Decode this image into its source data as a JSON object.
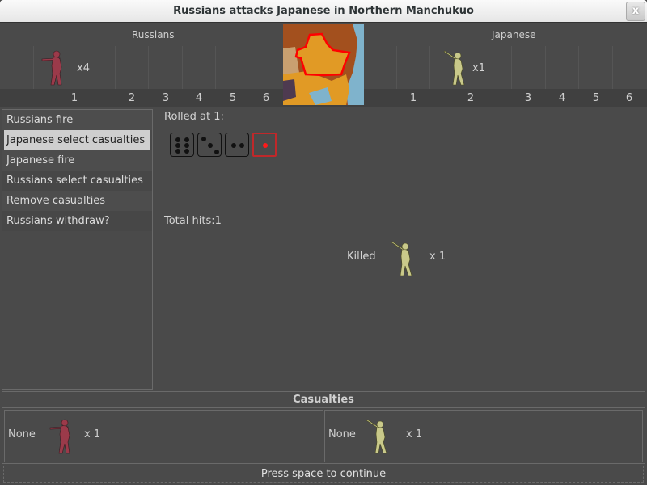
{
  "window": {
    "title": "Russians attacks Japanese in Northern Manchukuo",
    "close_label": "x"
  },
  "attacker": {
    "name": "Russians",
    "color": "#9b3a4a",
    "slots": [
      {
        "number": "1",
        "count": "x4"
      },
      {
        "number": "2"
      },
      {
        "number": "3"
      },
      {
        "number": "4"
      },
      {
        "number": "5"
      },
      {
        "number": "6"
      }
    ]
  },
  "defender": {
    "name": "Japanese",
    "color": "#c9c98a",
    "slots": [
      {
        "number": "1"
      },
      {
        "number": "2",
        "count": "x1"
      },
      {
        "number": "3"
      },
      {
        "number": "4"
      },
      {
        "number": "5"
      },
      {
        "number": "6"
      }
    ]
  },
  "territory": {
    "name": "Northern Manchukuo",
    "highlight_color": "#ff0000"
  },
  "phases": [
    {
      "label": "Russians fire",
      "selected": false
    },
    {
      "label": "Japanese select casualties",
      "selected": true
    },
    {
      "label": "Japanese fire",
      "selected": false
    },
    {
      "label": "Russians select casualties",
      "selected": false
    },
    {
      "label": "Remove casualties",
      "selected": false
    },
    {
      "label": "Russians withdraw?",
      "selected": false
    }
  ],
  "roll": {
    "label": "Rolled at 1:",
    "dice": [
      {
        "value": 6,
        "hit": false
      },
      {
        "value": 3,
        "hit": false
      },
      {
        "value": 2,
        "hit": false
      },
      {
        "value": 1,
        "hit": true
      }
    ],
    "hit_color": "#c0282a",
    "total_hits": "Total hits:1"
  },
  "killed": {
    "label": "Killed",
    "count": "x 1"
  },
  "casualties": {
    "title": "Casualties",
    "attacker": {
      "label": "None",
      "count": "x 1"
    },
    "defender": {
      "label": "None",
      "count": "x 1"
    }
  },
  "footer": {
    "continue_label": "Press space to continue"
  }
}
